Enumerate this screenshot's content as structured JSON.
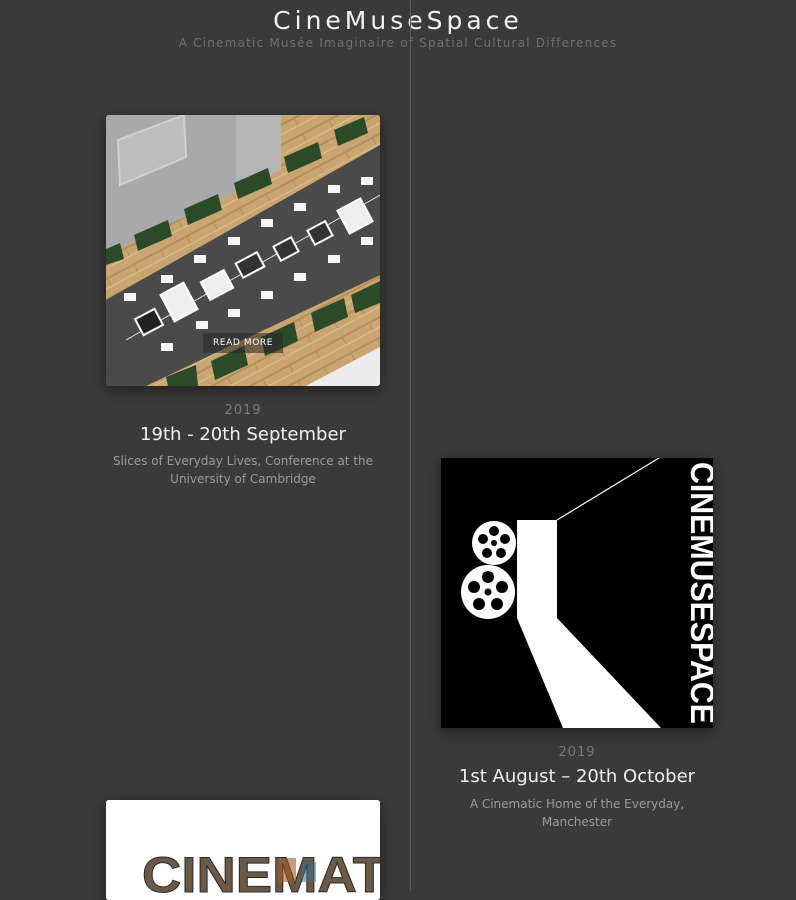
{
  "site": {
    "title": "CineMuseSpace",
    "subtitle": "A Cinematic Musée Imaginaire of Spatial Cultural Differences"
  },
  "colors": {
    "background": "#3a3a3a",
    "timeline": "#5c5c5c",
    "accent_text": "#f0f0f0"
  },
  "events": [
    {
      "year": "2019",
      "date": "19th - 20th September",
      "description_line1": "Slices of Everyday Lives, Conference at the",
      "description_line2": "University of Cambridge",
      "read_more": "READ MORE",
      "image": "gallery-floorplan-render"
    },
    {
      "year": "2019",
      "date": "1st August – 20th October",
      "description_line1": "A Cinematic Home of the Everyday,",
      "description_line2": "Manchester",
      "logo_text": "CINEMUSESPACE",
      "image": "projector-logo"
    },
    {
      "image_text": "CINEMAT",
      "image": "cinema-letters-collage"
    }
  ]
}
